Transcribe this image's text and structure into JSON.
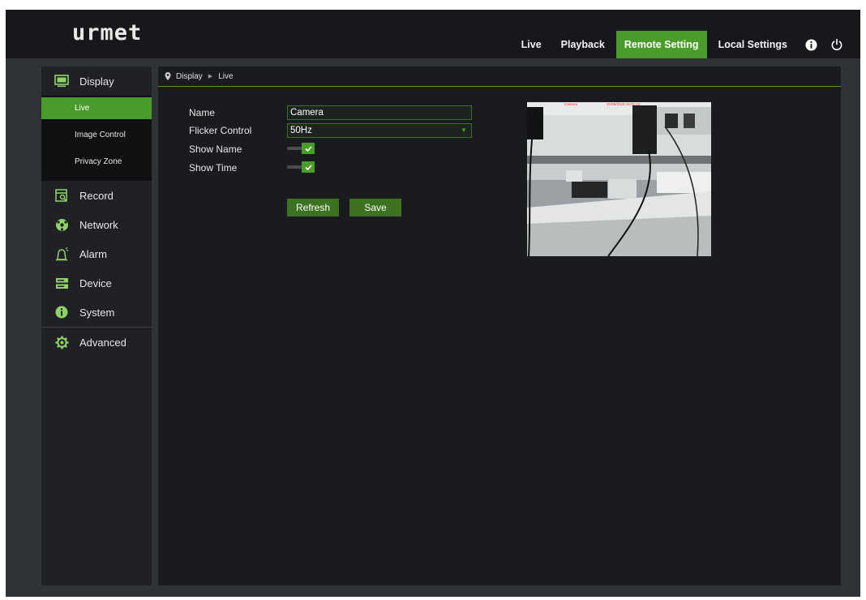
{
  "brand": {
    "logo": "urmet"
  },
  "topnav": {
    "items": [
      {
        "label": "Live"
      },
      {
        "label": "Playback"
      },
      {
        "label": "Remote Setting",
        "active": true
      },
      {
        "label": "Local Settings"
      }
    ],
    "icons": [
      "info-icon",
      "power-icon"
    ]
  },
  "sidebar": {
    "items": [
      {
        "label": "Display",
        "icon": "display-icon"
      },
      {
        "label": "Record",
        "icon": "record-icon"
      },
      {
        "label": "Network",
        "icon": "network-icon"
      },
      {
        "label": "Alarm",
        "icon": "alarm-icon"
      },
      {
        "label": "Device",
        "icon": "device-icon"
      },
      {
        "label": "System",
        "icon": "system-icon"
      },
      {
        "label": "Advanced",
        "icon": "advanced-icon"
      }
    ],
    "display_subitems": [
      {
        "label": "Live",
        "active": true
      },
      {
        "label": "Image Control"
      },
      {
        "label": "Privacy Zone"
      }
    ]
  },
  "breadcrumb": {
    "level1": "Display",
    "level2": "Live"
  },
  "form": {
    "name_label": "Name",
    "name_value": "Camera",
    "flicker_label": "Flicker Control",
    "flicker_value": "50Hz",
    "show_name_label": "Show Name",
    "show_name_checked": true,
    "show_time_label": "Show Time",
    "show_time_checked": true,
    "refresh_label": "Refresh",
    "save_label": "Save"
  },
  "preview": {
    "osd_name": "Camera",
    "osd_time": "21/06/2016 16:21:12"
  },
  "colors": {
    "accent": "#4a9c2a",
    "topbar": "#17181b",
    "sidebar": "#202125",
    "main": "#1a1b1e",
    "frame": "#2f3237"
  }
}
